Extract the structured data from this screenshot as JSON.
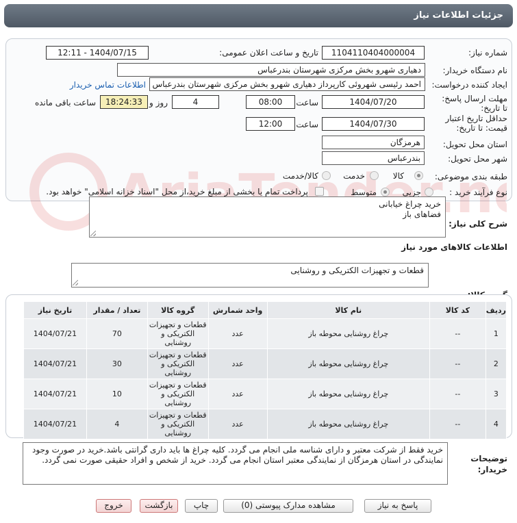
{
  "header": {
    "title": "جزئیات اطلاعات نیاز"
  },
  "form": {
    "need_number_label": "شماره نیاز:",
    "need_number": "1104110404000004",
    "announce_label": "تاریخ و ساعت اعلان عمومی:",
    "announce_value": "1404/07/15 - 12:11",
    "buyer_org_label": "نام دستگاه خریدار:",
    "buyer_org": "دهیاری شهرو بخش مرکزی شهرستان بندرعباس",
    "requester_label": "ایجاد کننده درخواست:",
    "requester": "احمد رئیسی شهروئی کارپرداز دهیاری شهرو بخش مرکزی شهرستان بندرعباس",
    "contact_link": "اطلاعات تماس خریدار",
    "deadline_label": "مهلت ارسال پاسخ: تا تاریخ:",
    "deadline_date": "1404/07/20",
    "time_label": "ساعت",
    "deadline_time": "08:00",
    "days_value": "4",
    "days_label": "روز و",
    "remaining_time": "18:24:33",
    "remaining_label": "ساعت باقی مانده",
    "validity_label": "حداقل تاریخ اعتبار قیمت: تا تاریخ:",
    "validity_date": "1404/07/30",
    "validity_time": "12:00",
    "province_label": "استان محل تحویل:",
    "province": "هرمزگان",
    "city_label": "شهر محل تحویل:",
    "city": "بندرعباس",
    "category_label": "طبقه بندی موضوعی:",
    "category_options": [
      "کالا",
      "خدمت",
      "کالا/خدمت"
    ],
    "process_label": "نوع فرآیند خرید :",
    "process_options": [
      "جزیی",
      "متوسط"
    ],
    "payment_note": "پرداخت تمام یا بخشی از مبلغ خرید،از محل \"اسناد خزانه اسلامی\" خواهد بود."
  },
  "description": {
    "label": "شرح کلی نیاز:",
    "text": "خرید چراغ خیابانی\nفضاهای باز"
  },
  "goods": {
    "section_title": "اطلاعات کالاهای مورد نیاز",
    "group_label": "گروه کالا:",
    "group_value": "قطعات و تجهیزات الکتریکی و روشنایی"
  },
  "table": {
    "headers": [
      "ردیف",
      "کد کالا",
      "نام کالا",
      "واحد شمارش",
      "گروه کالا",
      "تعداد / مقدار",
      "تاریخ نیاز"
    ],
    "rows": [
      [
        "1",
        "--",
        "چراغ روشنایی محوطه باز",
        "عدد",
        "قطعات و تجهیزات الکتریکی و روشنایی",
        "70",
        "1404/07/21"
      ],
      [
        "2",
        "--",
        "چراغ روشنایی محوطه باز",
        "عدد",
        "قطعات و تجهیزات الکتریکی و روشنایی",
        "30",
        "1404/07/21"
      ],
      [
        "3",
        "--",
        "چراغ روشنایی محوطه باز",
        "عدد",
        "قطعات و تجهیزات الکتریکی و روشنایی",
        "10",
        "1404/07/21"
      ],
      [
        "4",
        "--",
        "چراغ روشنایی محوطه باز",
        "عدد",
        "قطعات و تجهیزات الکتریکی و روشنایی",
        "4",
        "1404/07/21"
      ]
    ]
  },
  "buyer_notes": {
    "label": "توضیحات خریدار:",
    "text": "خرید فقط از شرکت معتبر و دارای شناسه ملی انجام می گردد. کلیه چراغ ها باید داری گرانتی باشد.خرید در صورت وجود نمایندگی در استان هرمزگان از نمایندگی معتبر استان  انجام می گردد. خرید از شخص و افراد حقیقی صورت نمی گردد."
  },
  "buttons": {
    "reply": "پاسخ به نیاز",
    "attachments": "مشاهده مدارک پیوستی (0)",
    "print": "چاپ",
    "back": "بازگشت",
    "exit": "خروج"
  },
  "watermark": "AriaTender.net"
}
